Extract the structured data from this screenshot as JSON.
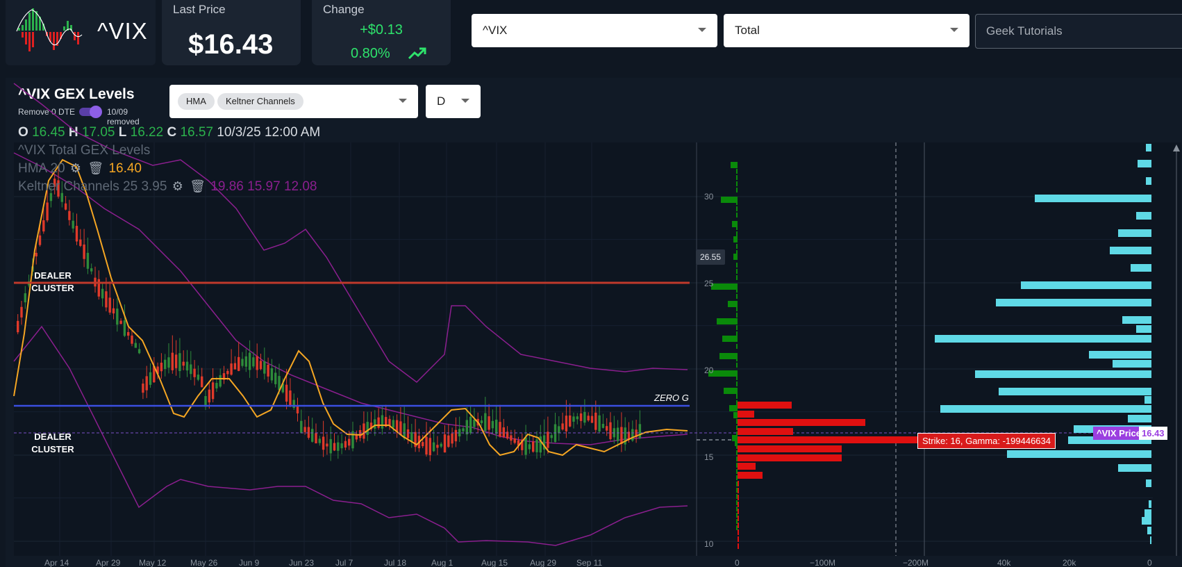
{
  "header": {
    "symbol": "^VIX",
    "last_price_label": "Last Price",
    "last_price": "$16.43",
    "change_label": "Change",
    "change_amount": "+$0.13",
    "change_pct": "0.80%",
    "symbol_select": "^VIX",
    "type_select": "Total",
    "source_input": "Geek Tutorials"
  },
  "panel": {
    "title": "^VIX GEX Levels",
    "toggle_left": "Remove 0 DTE",
    "toggle_right": "10/09 removed",
    "indicators": [
      "HMA",
      "Keltner Channels"
    ],
    "interval": "D"
  },
  "ohlc": {
    "o_key": "O",
    "o": "16.45",
    "h_key": "H",
    "h": "17.05",
    "l_key": "L",
    "l": "16.22",
    "c_key": "C",
    "c": "16.57",
    "date": "10/3/25 12:00 AM"
  },
  "legend": {
    "series": "^VIX Total GEX Levels",
    "hma_name": "HMA",
    "hma_param": "20",
    "hma_value": "16.40",
    "kc_name": "Keltner Channels",
    "kc_params": "25 3.95",
    "kc_values": "19.86 15.97 12.08"
  },
  "annotations": {
    "dealer_cluster_top": [
      "DEALER",
      "CLUSTER"
    ],
    "dealer_cluster_bottom": [
      "DEALER",
      "CLUSTER"
    ],
    "zero_g": "ZERO G",
    "crosshair_price": "26.55",
    "strike_tooltip": "Strike: 16, Gamma: -199446634",
    "vix_price_label": "^VIX Price",
    "vix_price_value": "16.43"
  },
  "colors": {
    "dealer_line": "#c0392b",
    "zero_g_line": "#3b4fe0",
    "hma": "#f5a623",
    "keltner": "#8b1f8f",
    "gex_positive": "#0a8a0a",
    "gex_negative": "#e01010",
    "oi_bars": "#5fd9e6",
    "accent": "#9b3fe0"
  },
  "chart_data": {
    "type": "line",
    "x_tick_labels": [
      "Apr 14",
      "Apr 29",
      "May 12",
      "May 26",
      "Jun 9",
      "Jun 23",
      "Jul 7",
      "Jul 18",
      "Aug 1",
      "Aug 15",
      "Aug 29",
      "Sep 11"
    ],
    "price_axis_labels": [
      "30",
      "25",
      "20",
      "15",
      "10"
    ],
    "gex_axis_labels": [
      "0",
      "−100M",
      "−200M"
    ],
    "oi_axis_labels": [
      "40k",
      "20k",
      "0"
    ],
    "dealer_cluster_levels": [
      25,
      16
    ],
    "zero_g_level": 18,
    "last_price": 16.43
  }
}
